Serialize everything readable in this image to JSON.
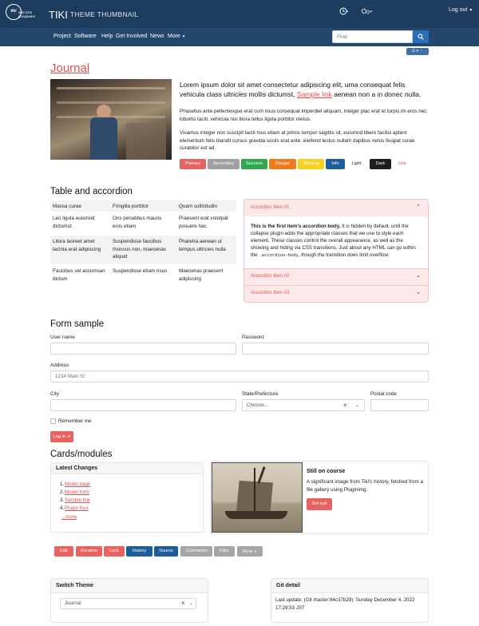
{
  "header": {
    "logo_text": "tiki",
    "logo_tagline": "wiki cms groupware",
    "title": "TIKI",
    "subtitle": "THEME THUMBNAIL",
    "clock_icon": "clock-icon",
    "gear_icon": "gear-icon",
    "logout_label": "Log out"
  },
  "nav": {
    "items": [
      "Project",
      "Software",
      "Help",
      "Get Involved",
      "News",
      "More"
    ],
    "search_placeholder": "Find"
  },
  "page": {
    "title": "Journal",
    "lead_before": "Lorem ipsum dolor sit amet consectetur adipiscing elit, uma consequat felis vehicula class ultricies mollis dictumst, ",
    "lead_link": "Sample link",
    "lead_after": " aenean non a in donec nulla.",
    "para1": "Phasellus ante pellentesque erat cum risus consequat imperdiet aliquam, integer plac erat et turpis mi eros nec lobortis taciti, vehicula nisi litora tellus ligula porttitor metus.",
    "para2": "Vivamus integer non suscipit taciti mus etiam at primis tempor sagittis sit, euismod libero facilisi aptent elementum felis blandit cursus gravida sociis erat ante, eleifend lectus nullam dapibus netus feugiat curae curabitur est ad.",
    "buttons": [
      "Primary",
      "Secondary",
      "Success",
      "Danger",
      "Warning",
      "Info",
      "Light",
      "Dark",
      "Link"
    ]
  },
  "table_section": {
    "title": "Table and accordion",
    "rows": [
      [
        "Massa curae",
        "Fringilla porttitor",
        "Quam sollicitudin"
      ],
      [
        "Leo ligula euismod dictumst",
        "Orci penatibus mauris eros etiam",
        "Praesent erat volutpat posuere hac"
      ],
      [
        "Litora laoreet amet lacinia erat adipiscing",
        "Suspendisse faucibus rhoncus non, maecenas aliquet",
        "Pharetra aenean ut tempus ultricies nulla"
      ],
      [
        "Faucibus vel accumsan dictum",
        "Suspendisse etiam risus",
        "Maecenas praesent adipiscing"
      ]
    ],
    "accordion": [
      {
        "label": "Accordion Item #1",
        "open": true
      },
      {
        "label": "Accordion Item #2",
        "open": false
      },
      {
        "label": "Accordion Item #3",
        "open": false
      }
    ],
    "accordion_body_bold": "This is the first item's accordion body.",
    "accordion_body": " It is hidden by default, until the collapse plugin adds the appropriate classes that we use to style each element. These classes control the overall appearance, as well as the showing and hiding via CSS transitions. Just about any HTML can go within the ",
    "accordion_code": ".accordion-body",
    "accordion_body_end": ", though the transition does limit overflow."
  },
  "form": {
    "title": "Form sample",
    "user_label": "User name",
    "password_label": "Password",
    "address_label": "Address",
    "address_placeholder": "1234 Main St",
    "city_label": "City",
    "state_label": "State/Prefecture",
    "state_value": "Choose...",
    "postal_label": "Postal code",
    "remember_label": "Remember me",
    "login_label": "Log in"
  },
  "cards": {
    "title": "Cards/modules",
    "latest_title": "Latest Changes",
    "latest_items": [
      "Model page",
      "Model form",
      "Sample link",
      "Plugin four"
    ],
    "more_label": "...more",
    "image_title": "Still on course",
    "image_text": "A significant image from Tiki's history, fetched from a file gallery using Pluginimg.",
    "image_button": "Set sail"
  },
  "actions": [
    "Edit",
    "Rename",
    "Lock",
    "History",
    "Source",
    "Comments",
    "Files",
    "More"
  ],
  "footer": {
    "switch_title": "Switch Theme",
    "theme_value": "Journal",
    "git_title": "Git detail",
    "git_text": "Last update: (Git master:64c37b29): Sunday December 4, 2022 17:29:53 JST"
  },
  "colors": {
    "navbar": "#1d3c5e",
    "primary": "#e8625f",
    "link": "#e35050",
    "info": "#1f5d99"
  }
}
